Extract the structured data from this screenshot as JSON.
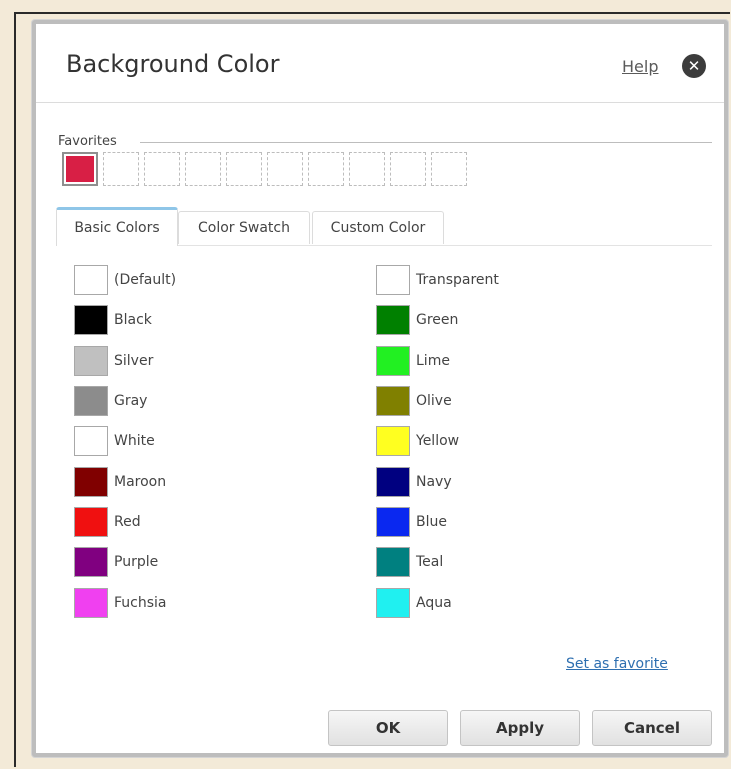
{
  "dialog": {
    "title": "Background Color",
    "help_label": "Help",
    "close_glyph": "✕"
  },
  "favorites": {
    "legend": "Favorites",
    "slots": [
      "#d81f45",
      "",
      "",
      "",
      "",
      "",
      "",
      "",
      "",
      ""
    ]
  },
  "tabs": [
    {
      "label": "Basic Colors",
      "active": true
    },
    {
      "label": "Color Swatch",
      "active": false
    },
    {
      "label": "Custom Color",
      "active": false
    }
  ],
  "colors_left": [
    {
      "name": "(Default)",
      "hex": "#ffffff"
    },
    {
      "name": "Black",
      "hex": "#000000"
    },
    {
      "name": "Silver",
      "hex": "#c0c0c0"
    },
    {
      "name": "Gray",
      "hex": "#8c8c8c"
    },
    {
      "name": "White",
      "hex": "#ffffff"
    },
    {
      "name": "Maroon",
      "hex": "#800000"
    },
    {
      "name": "Red",
      "hex": "#f01010"
    },
    {
      "name": "Purple",
      "hex": "#800080"
    },
    {
      "name": "Fuchsia",
      "hex": "#f040f0"
    }
  ],
  "colors_right": [
    {
      "name": "Transparent",
      "hex": "#ffffff"
    },
    {
      "name": "Green",
      "hex": "#008000"
    },
    {
      "name": "Lime",
      "hex": "#22f022"
    },
    {
      "name": "Olive",
      "hex": "#808000"
    },
    {
      "name": "Yellow",
      "hex": "#ffff20"
    },
    {
      "name": "Navy",
      "hex": "#000080"
    },
    {
      "name": "Blue",
      "hex": "#0a28f0"
    },
    {
      "name": "Teal",
      "hex": "#008080"
    },
    {
      "name": "Aqua",
      "hex": "#20f0f0"
    }
  ],
  "set_favorite_label": "Set as favorite",
  "buttons": {
    "ok": "OK",
    "apply": "Apply",
    "cancel": "Cancel"
  }
}
